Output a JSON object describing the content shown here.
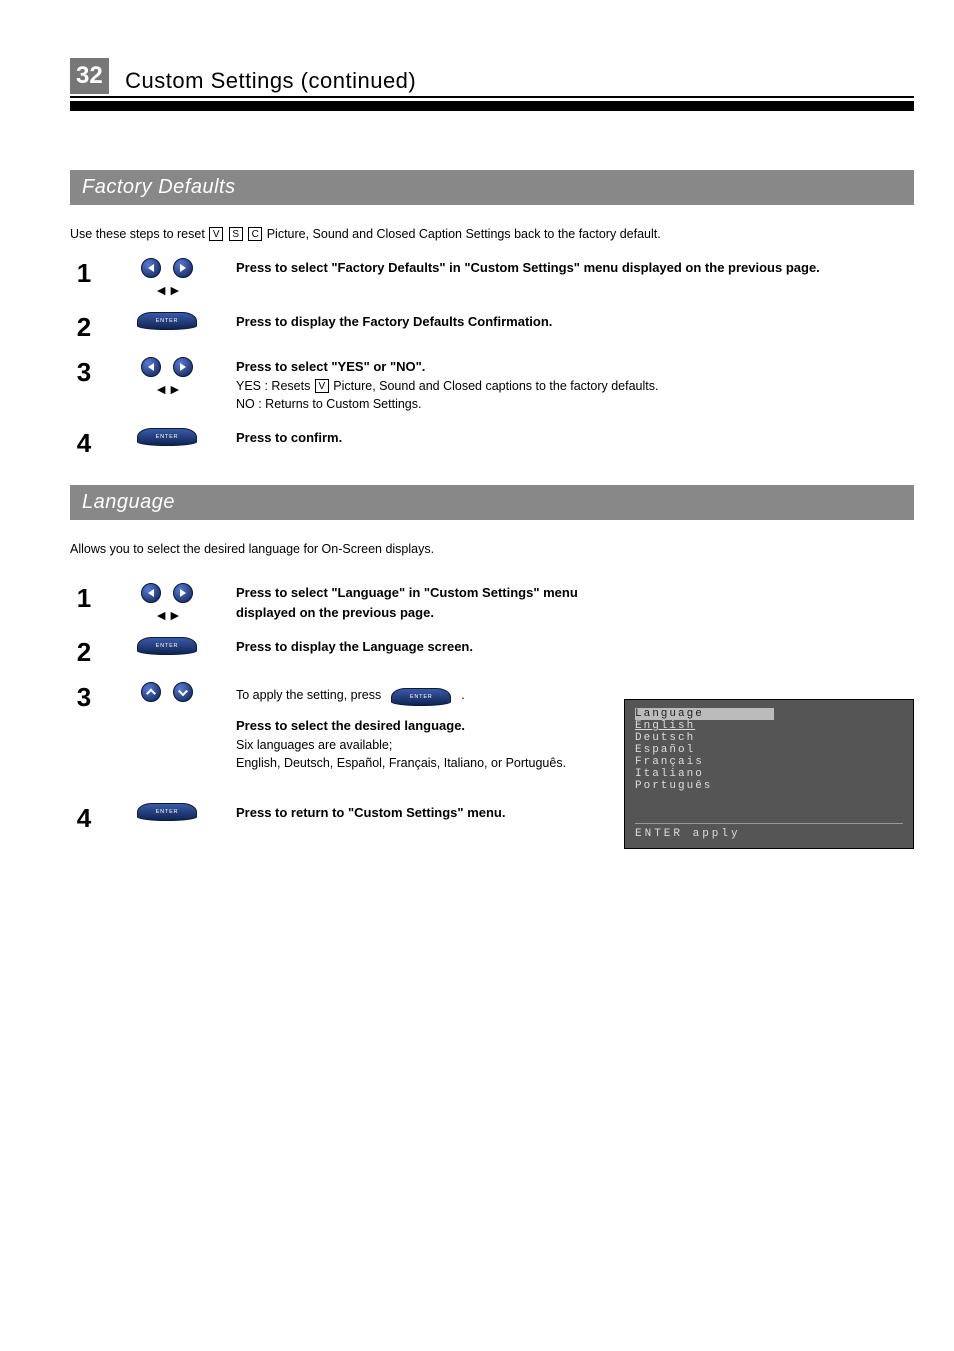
{
  "page_number": "32",
  "page_title": "Custom Settings (continued)",
  "sections": {
    "factory": {
      "bar": "Factory Defaults",
      "intro_a": "Use these steps to reset ",
      "intro_b": " Picture, Sound and Closed Caption Settings back to the factory default.",
      "steps": [
        {
          "num": "1",
          "icons": "lr",
          "bold": "Press to select \"Factory Defaults\" in \"Custom Settings\" menu displayed on the previous page."
        },
        {
          "num": "2",
          "icons": "enter",
          "bold": "Press to display the Factory Defaults Confirmation."
        },
        {
          "num": "3",
          "icons": "lr",
          "bold": "Press to select \"YES\" or \"NO\".",
          "extra": "YES : Resets ",
          "extra2": " Picture, Sound and Closed captions to the factory defaults.",
          "extra3": "NO : Returns to Custom Settings."
        },
        {
          "num": "4",
          "icons": "enter",
          "bold": "Press to confirm."
        }
      ]
    },
    "language": {
      "bar": "Language",
      "intro": "Allows you to select the desired language for On-Screen displays.",
      "steps": [
        {
          "num": "1",
          "icons": "lr",
          "bold": "Press to select \"Language\" in \"Custom Settings\" menu displayed on the previous page."
        },
        {
          "num": "2",
          "icons": "enter",
          "bold": "Press to display the Language screen."
        },
        {
          "num": "3",
          "icons": "ud",
          "extra": "To apply the setting, press ",
          "extra2": ".",
          "bold": "Press to select the desired language.",
          "list_intro": "Six languages are available;",
          "list": "English, Deutsch, Español, Français, Italiano, or Português."
        },
        {
          "num": "4",
          "icons": "enter",
          "bold": "Press to return to \"Custom Settings\" menu."
        }
      ],
      "osd": {
        "title": "Language",
        "items": [
          "English",
          "Deutsch",
          "Español",
          "Français",
          "Italiano",
          "Português"
        ],
        "apply": "ENTER apply"
      }
    }
  }
}
